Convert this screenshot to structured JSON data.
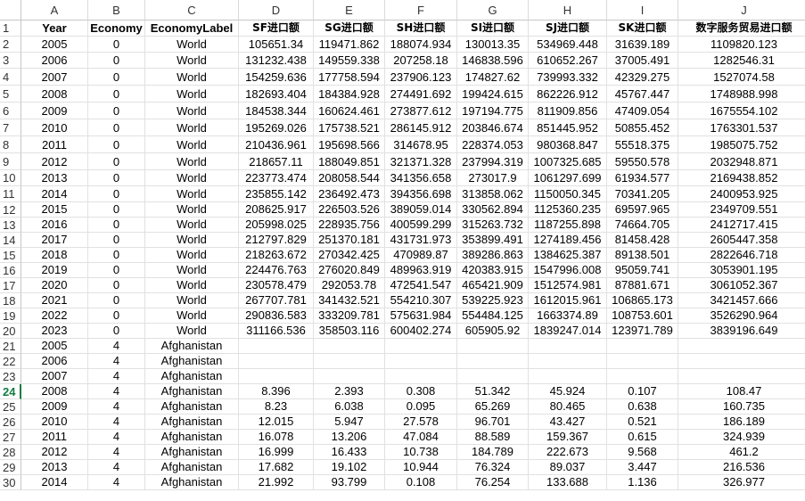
{
  "sheet": {
    "column_letters": [
      "A",
      "B",
      "C",
      "D",
      "E",
      "F",
      "G",
      "H",
      "I",
      "J"
    ],
    "row_numbers": [
      "1",
      "2",
      "3",
      "4",
      "5",
      "6",
      "7",
      "8",
      "9",
      "10",
      "11",
      "12",
      "13",
      "14",
      "15",
      "16",
      "17",
      "18",
      "19",
      "20",
      "21",
      "22",
      "23",
      "24",
      "25",
      "26",
      "27",
      "28",
      "29",
      "30"
    ],
    "active_row": "24",
    "headers": [
      "Year",
      "Economy",
      "EconomyLabel",
      "SF进口额",
      "SG进口额",
      "SH进口额",
      "SI进口额",
      "SJ进口额",
      "SK进口额",
      "数字服务贸易进口额"
    ],
    "rows": [
      [
        "2005",
        "0",
        "World",
        "105651.34",
        "119471.862",
        "188074.934",
        "130013.35",
        "534969.448",
        "31639.189",
        "1109820.123"
      ],
      [
        "2006",
        "0",
        "World",
        "131232.438",
        "149559.338",
        "207258.18",
        "146838.596",
        "610652.267",
        "37005.491",
        "1282546.31"
      ],
      [
        "2007",
        "0",
        "World",
        "154259.636",
        "177758.594",
        "237906.123",
        "174827.62",
        "739993.332",
        "42329.275",
        "1527074.58"
      ],
      [
        "2008",
        "0",
        "World",
        "182693.404",
        "184384.928",
        "274491.692",
        "199424.615",
        "862226.912",
        "45767.447",
        "1748988.998"
      ],
      [
        "2009",
        "0",
        "World",
        "184538.344",
        "160624.461",
        "273877.612",
        "197194.775",
        "811909.856",
        "47409.054",
        "1675554.102"
      ],
      [
        "2010",
        "0",
        "World",
        "195269.026",
        "175738.521",
        "286145.912",
        "203846.674",
        "851445.952",
        "50855.452",
        "1763301.537"
      ],
      [
        "2011",
        "0",
        "World",
        "210436.961",
        "195698.566",
        "314678.95",
        "228374.053",
        "980368.847",
        "55518.375",
        "1985075.752"
      ],
      [
        "2012",
        "0",
        "World",
        "218657.11",
        "188049.851",
        "321371.328",
        "237994.319",
        "1007325.685",
        "59550.578",
        "2032948.871"
      ],
      [
        "2013",
        "0",
        "World",
        "223773.474",
        "208058.544",
        "341356.658",
        "273017.9",
        "1061297.699",
        "61934.577",
        "2169438.852"
      ],
      [
        "2014",
        "0",
        "World",
        "235855.142",
        "236492.473",
        "394356.698",
        "313858.062",
        "1150050.345",
        "70341.205",
        "2400953.925"
      ],
      [
        "2015",
        "0",
        "World",
        "208625.917",
        "226503.526",
        "389059.014",
        "330562.894",
        "1125360.235",
        "69597.965",
        "2349709.551"
      ],
      [
        "2016",
        "0",
        "World",
        "205998.025",
        "228935.756",
        "400599.299",
        "315263.732",
        "1187255.898",
        "74664.705",
        "2412717.415"
      ],
      [
        "2017",
        "0",
        "World",
        "212797.829",
        "251370.181",
        "431731.973",
        "353899.491",
        "1274189.456",
        "81458.428",
        "2605447.358"
      ],
      [
        "2018",
        "0",
        "World",
        "218263.672",
        "270342.425",
        "470989.87",
        "389286.863",
        "1384625.387",
        "89138.501",
        "2822646.718"
      ],
      [
        "2019",
        "0",
        "World",
        "224476.763",
        "276020.849",
        "489963.919",
        "420383.915",
        "1547996.008",
        "95059.741",
        "3053901.195"
      ],
      [
        "2020",
        "0",
        "World",
        "230578.479",
        "292053.78",
        "472541.547",
        "465421.909",
        "1512574.981",
        "87881.671",
        "3061052.367"
      ],
      [
        "2021",
        "0",
        "World",
        "267707.781",
        "341432.521",
        "554210.307",
        "539225.923",
        "1612015.961",
        "106865.173",
        "3421457.666"
      ],
      [
        "2022",
        "0",
        "World",
        "290836.583",
        "333209.781",
        "575631.984",
        "554484.125",
        "1663374.89",
        "108753.601",
        "3526290.964"
      ],
      [
        "2023",
        "0",
        "World",
        "311166.536",
        "358503.116",
        "600402.274",
        "605905.92",
        "1839247.014",
        "123971.789",
        "3839196.649"
      ],
      [
        "2005",
        "4",
        "Afghanistan",
        "",
        "",
        "",
        "",
        "",
        "",
        ""
      ],
      [
        "2006",
        "4",
        "Afghanistan",
        "",
        "",
        "",
        "",
        "",
        "",
        ""
      ],
      [
        "2007",
        "4",
        "Afghanistan",
        "",
        "",
        "",
        "",
        "",
        "",
        ""
      ],
      [
        "2008",
        "4",
        "Afghanistan",
        "8.396",
        "2.393",
        "0.308",
        "51.342",
        "45.924",
        "0.107",
        "108.47"
      ],
      [
        "2009",
        "4",
        "Afghanistan",
        "8.23",
        "6.038",
        "0.095",
        "65.269",
        "80.465",
        "0.638",
        "160.735"
      ],
      [
        "2010",
        "4",
        "Afghanistan",
        "12.015",
        "5.947",
        "27.578",
        "96.701",
        "43.427",
        "0.521",
        "186.189"
      ],
      [
        "2011",
        "4",
        "Afghanistan",
        "16.078",
        "13.206",
        "47.084",
        "88.589",
        "159.367",
        "0.615",
        "324.939"
      ],
      [
        "2012",
        "4",
        "Afghanistan",
        "16.999",
        "16.433",
        "10.738",
        "184.789",
        "222.673",
        "9.568",
        "461.2"
      ],
      [
        "2013",
        "4",
        "Afghanistan",
        "17.682",
        "19.102",
        "10.944",
        "76.324",
        "89.037",
        "3.447",
        "216.536"
      ],
      [
        "2014",
        "4",
        "Afghanistan",
        "21.992",
        "93.799",
        "0.108",
        "76.254",
        "133.688",
        "1.136",
        "326.977"
      ]
    ]
  }
}
